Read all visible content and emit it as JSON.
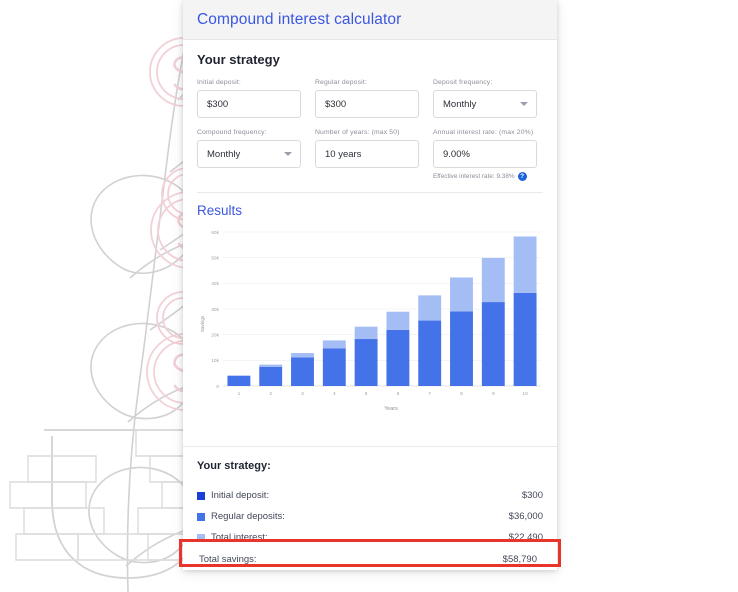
{
  "card": {
    "title": "Compound interest calculator"
  },
  "strategy": {
    "heading": "Your strategy",
    "fields": [
      {
        "label": "Initial deposit:",
        "value": "$300",
        "type": "input",
        "name": "initial-deposit"
      },
      {
        "label": "Regular deposit:",
        "value": "$300",
        "type": "input",
        "name": "regular-deposit"
      },
      {
        "label": "Deposit frequency:",
        "value": "Monthly",
        "type": "select",
        "name": "deposit-frequency"
      },
      {
        "label": "Compound frequency:",
        "value": "Monthly",
        "type": "select",
        "name": "compound-frequency"
      },
      {
        "label": "Number of years: (max 50)",
        "value": "10 years",
        "type": "input",
        "name": "number-of-years"
      },
      {
        "label": "Annual interest rate: (max 20%)",
        "value": "9.00%",
        "type": "input",
        "name": "annual-interest-rate"
      }
    ],
    "effective_rate_text": "Effective interest rate: 9.38%",
    "help_icon_glyph": "?"
  },
  "results": {
    "heading": "Results"
  },
  "chart_data": {
    "type": "bar",
    "stacked": true,
    "title": "",
    "xlabel": "Years",
    "ylabel": "Savings",
    "categories": [
      "1",
      "2",
      "3",
      "4",
      "5",
      "6",
      "7",
      "8",
      "9",
      "10"
    ],
    "ylim": [
      0,
      60000
    ],
    "yticks": [
      0,
      10000,
      20000,
      30000,
      40000,
      50000,
      60000
    ],
    "ytick_labels": [
      "0",
      "10k",
      "20k",
      "30k",
      "40k",
      "50k",
      "60k"
    ],
    "grid": true,
    "legend_position": "below-chart",
    "series": [
      {
        "name": "Deposits",
        "color": "#4472e8",
        "values": [
          3900,
          7500,
          11100,
          14700,
          18300,
          21900,
          25500,
          29100,
          32700,
          36300
        ]
      },
      {
        "name": "Total interest",
        "color": "#a5bdf5",
        "values": [
          260,
          830,
          1750,
          3060,
          4810,
          7040,
          9810,
          13180,
          17210,
          21960
        ]
      }
    ],
    "totals": [
      4160,
      8330,
      12850,
      17760,
      23110,
      28940,
      35310,
      42280,
      49910,
      58260
    ]
  },
  "summary": {
    "title": "Your strategy:",
    "rows": [
      {
        "label": "Initial deposit:",
        "value": "$300",
        "color": "#1b3fd8"
      },
      {
        "label": "Regular deposits:",
        "value": "$36,000",
        "color": "#4472e8"
      },
      {
        "label": "Total interest:",
        "value": "$22,490",
        "color": "#a5bdf5"
      }
    ],
    "total": {
      "label": "Total savings:",
      "value": "$58,790"
    }
  },
  "colors": {
    "brand_blue": "#3b57e0",
    "bar_dark": "#4472e8",
    "bar_light": "#a5bdf5",
    "highlight_red": "#e8352b"
  }
}
